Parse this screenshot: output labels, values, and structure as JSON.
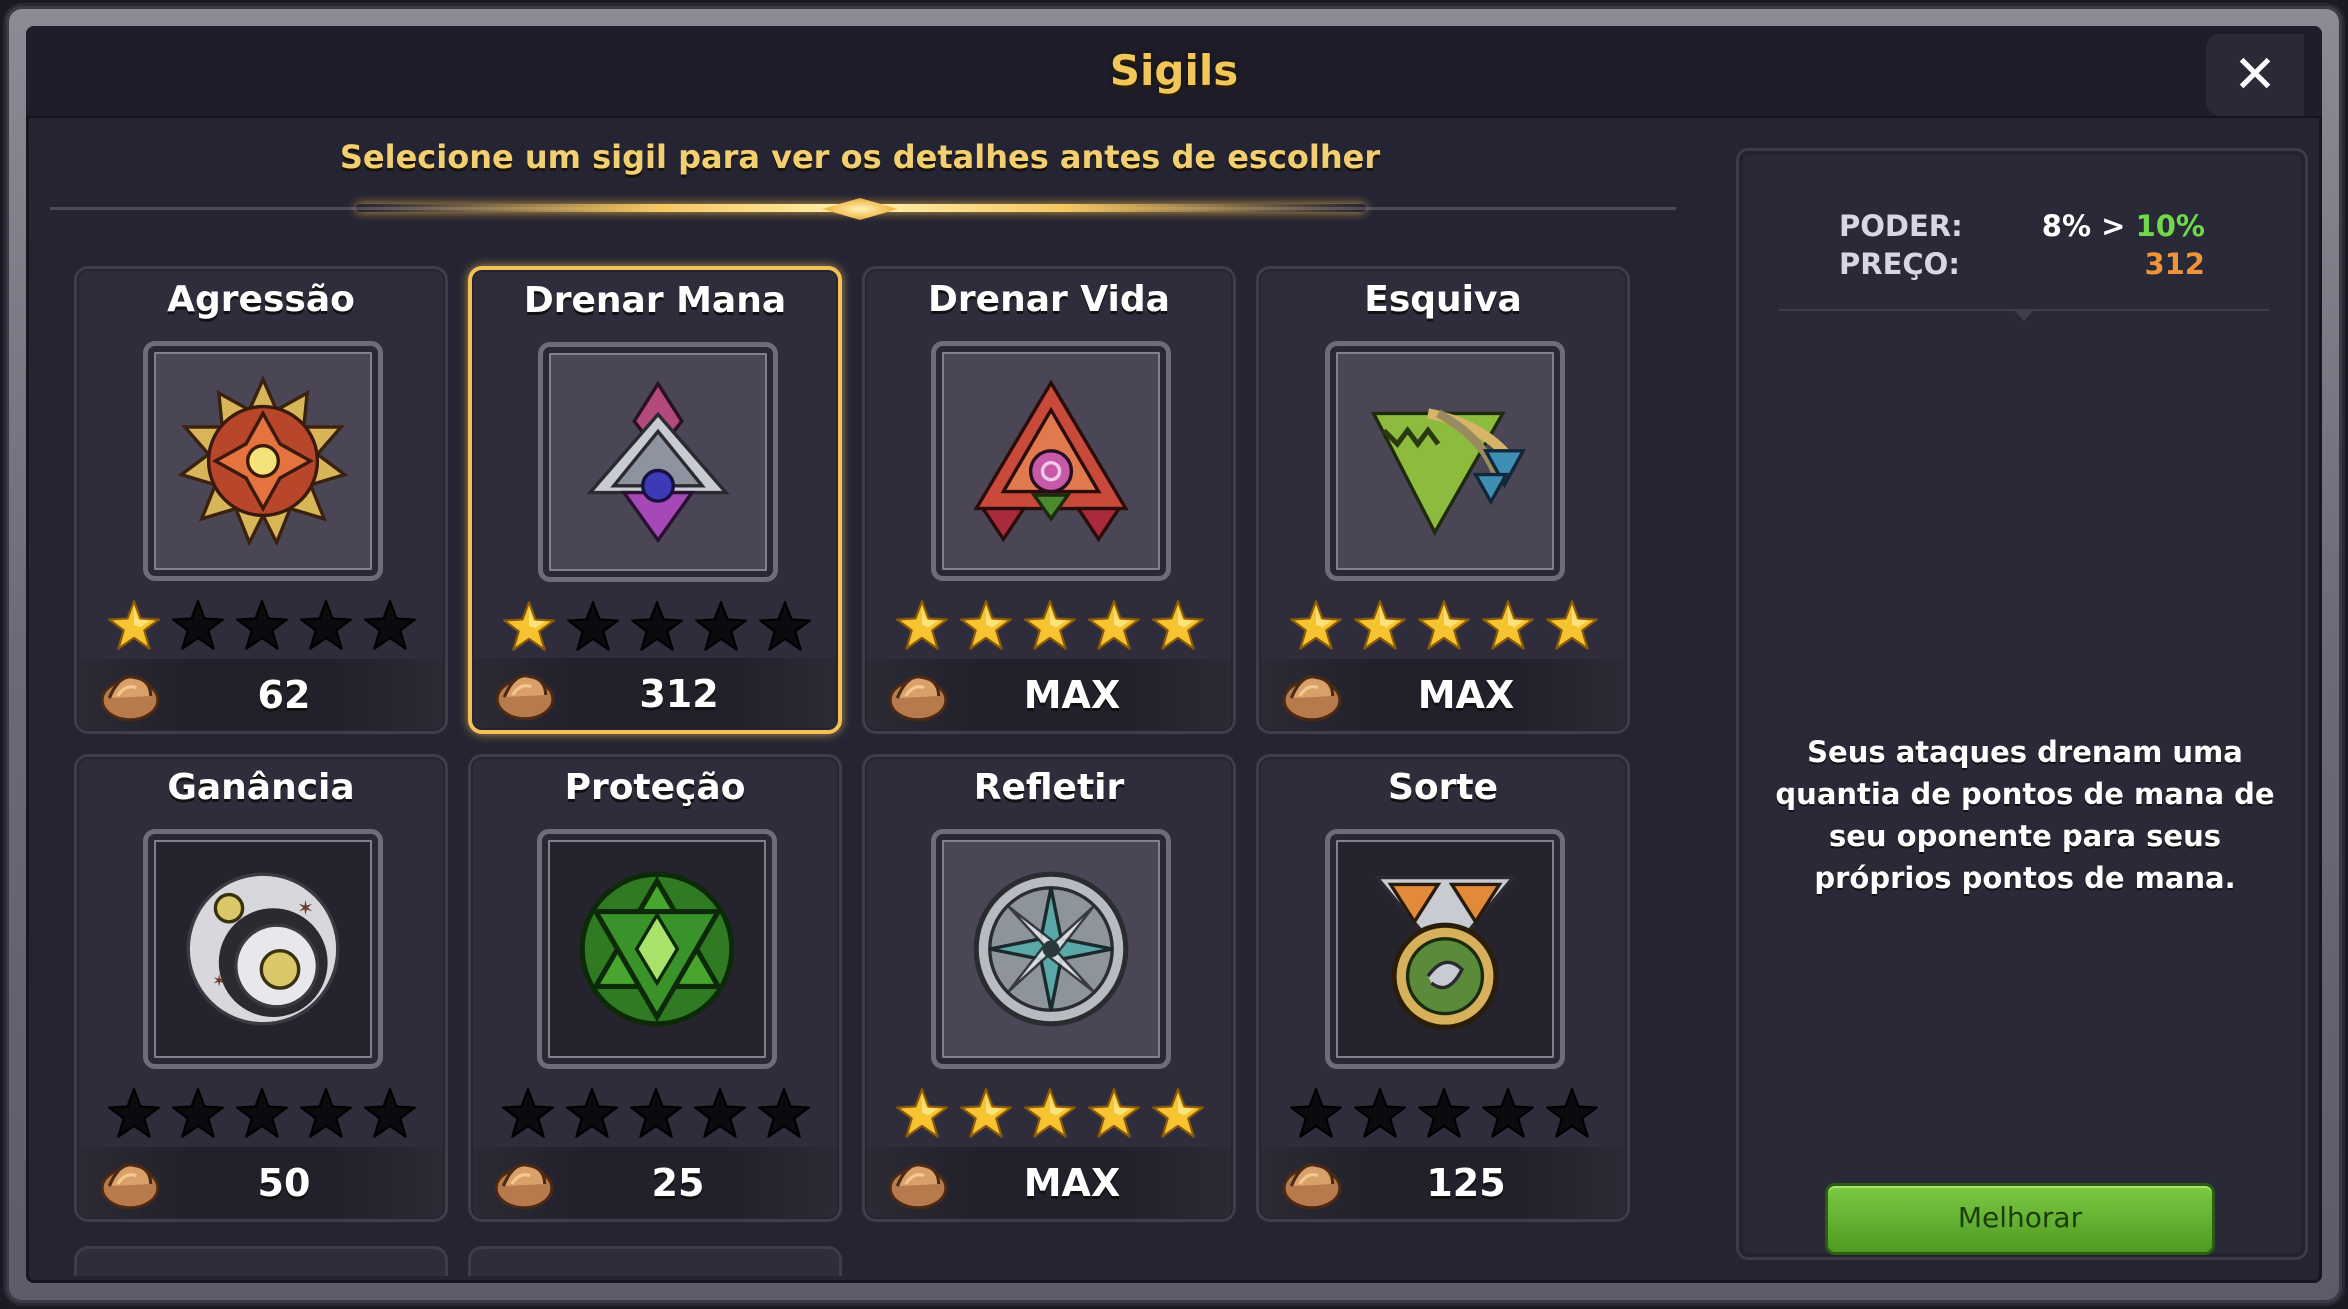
{
  "window": {
    "title": "Sigils",
    "close_icon": "✕"
  },
  "subtitle": "Selecione um sigil para ver os detalhes antes de escolher",
  "colors": {
    "gold": "#f2c75a",
    "green": "#6fd84b",
    "orange": "#f0943c",
    "star_on": "#f7c431",
    "star_off": "#0b0b0f"
  },
  "sigils": [
    {
      "name": "Agressão",
      "stars": 1,
      "max_stars": 5,
      "price": "62",
      "icon": "agressao-sigil-icon",
      "selected": false
    },
    {
      "name": "Drenar Mana",
      "stars": 1,
      "max_stars": 5,
      "price": "312",
      "icon": "drenar-mana-sigil-icon",
      "selected": true
    },
    {
      "name": "Drenar Vida",
      "stars": 5,
      "max_stars": 5,
      "price": "MAX",
      "icon": "drenar-vida-sigil-icon",
      "selected": false
    },
    {
      "name": "Esquiva",
      "stars": 5,
      "max_stars": 5,
      "price": "MAX",
      "icon": "esquiva-sigil-icon",
      "selected": false
    },
    {
      "name": "Ganância",
      "stars": 0,
      "max_stars": 5,
      "price": "50",
      "icon": "ganancia-sigil-icon",
      "selected": false
    },
    {
      "name": "Proteção",
      "stars": 0,
      "max_stars": 5,
      "price": "25",
      "icon": "protecao-sigil-icon",
      "selected": false
    },
    {
      "name": "Refletir",
      "stars": 5,
      "max_stars": 5,
      "price": "MAX",
      "icon": "refletir-sigil-icon",
      "selected": false
    },
    {
      "name": "Sorte",
      "stars": 0,
      "max_stars": 5,
      "price": "125",
      "icon": "sorte-sigil-icon",
      "selected": false
    }
  ],
  "details": {
    "power_label": "PODER:",
    "power_old": "8%",
    "power_arrow": ">",
    "power_new": "10%",
    "price_label": "PREÇO:",
    "price_value": "312",
    "description": "Seus ataques drenam uma quantia de pontos de mana de seu oponente para seus próprios pontos de mana.",
    "upgrade_label": "Melhorar"
  }
}
